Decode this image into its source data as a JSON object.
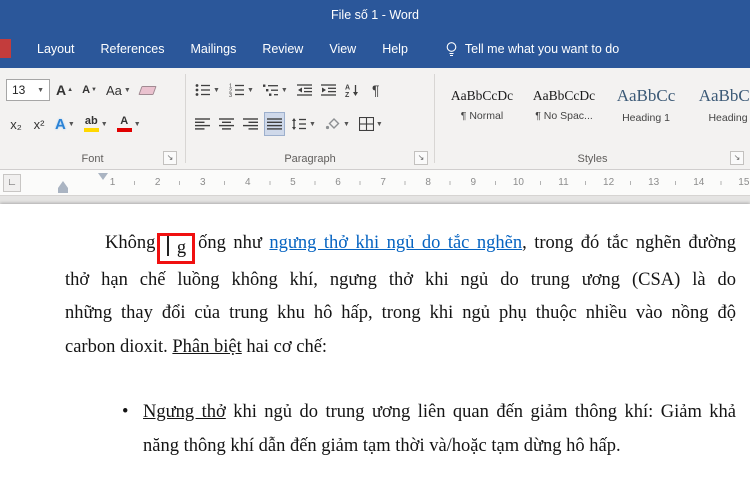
{
  "colors": {
    "titlebar_blue": "#2b579a",
    "hyperlink_blue": "#0563c1",
    "highlight_yellow": "#ffd800",
    "font_color_red": "#e00000",
    "annotation_red": "#f01010"
  },
  "titlebar": {
    "title": "File số 1 - Word"
  },
  "tabs": {
    "items": [
      {
        "label": "Layout"
      },
      {
        "label": "References"
      },
      {
        "label": "Mailings"
      },
      {
        "label": "Review"
      },
      {
        "label": "View"
      },
      {
        "label": "Help"
      }
    ],
    "tell_me": "Tell me what you want to do"
  },
  "ribbon": {
    "font_group": {
      "label": "Font",
      "font_size": "13",
      "grow_font": "A",
      "shrink_font": "A",
      "change_case": "Aa",
      "subscript": "x₂",
      "superscript": "x²",
      "text_effects": "A",
      "highlight": "ab",
      "font_color": "A"
    },
    "paragraph_group": {
      "label": "Paragraph",
      "pilcrow": "¶"
    },
    "styles_group": {
      "label": "Styles",
      "styles": [
        {
          "sample": "AaBbCcDc",
          "name": "¶ Normal"
        },
        {
          "sample": "AaBbCcDc",
          "name": "¶ No Spac..."
        },
        {
          "sample": "AaBbCc",
          "name": "Heading 1"
        },
        {
          "sample": "AaBbCc",
          "name": "Heading"
        }
      ]
    }
  },
  "ruler": {
    "numbers": [
      "1",
      "2",
      "3",
      "4",
      "5",
      "6",
      "7",
      "8",
      "9",
      "10",
      "11",
      "12",
      "13",
      "14",
      "15"
    ]
  },
  "document": {
    "p1": {
      "l1_a": "Không",
      "l1_cursor_char": "g",
      "l1_b": "ống như ",
      "l1_link": "ngưng thở khi ngủ do tắc nghẽn",
      "l1_c": ", trong đó tắc nghẽn đường",
      "l2": "thở hạn chế luồng không khí, ngưng thở khi ngủ do trung ương (CSA) là do",
      "l3": "những thay đổi của trung khu hô hấp, trong khi ngủ phụ thuộc nhiều vào nồng độ",
      "l4_a": "carbon dioxit. ",
      "l4_u": "Phân biệt",
      "l4_b": " hai cơ chế:"
    },
    "bullet1": {
      "marker": "•",
      "u": "Ngưng thở",
      "l1_rest": " khi ngủ do trung ương liên quan đến giảm thông khí: Giảm khả",
      "l2": "năng thông khí dẫn đến giảm tạm thời và/hoặc tạm dừng hô hấp."
    }
  }
}
